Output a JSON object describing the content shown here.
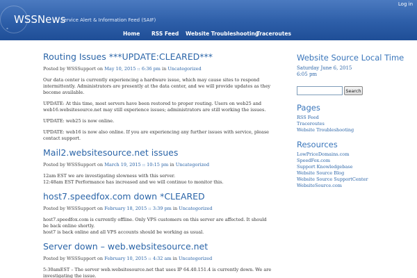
{
  "header": {
    "title": "WSSNews",
    "tagline": "Service Alert & Information Feed (SAIF)",
    "login": "Log in",
    "mark": "°"
  },
  "nav": [
    "Home",
    "RSS Feed",
    "Website Troubleshooting",
    "Traceroutes"
  ],
  "posts": [
    {
      "title": "Routing Issues ***UPDATE:CLEARED***",
      "meta": {
        "posted_by": "Posted by",
        "author": "WSSSupport",
        "on": "on",
        "date": "May 10, 2015 :: 6:36 pm",
        "in": "in",
        "category": "Uncategorized"
      },
      "paragraphs": [
        "Our data center is currently experiencing a hardware issue, which may cause sites to respond intermittently. Administrators are presently at the data center, and we will provide updates as they become available.",
        "UPDATE: At this time, most servers have been restored to proper routing. Users on web25 and web16.websitesource.net may still experience issues; administrators are still working the issues.",
        "UPDATE: web25 is now online.",
        "UPDATE: web16 is now also online. If you are experiencing any further issues with service, please contact support."
      ]
    },
    {
      "title": "Mail2.websitesource.net issues",
      "meta": {
        "posted_by": "Posted by",
        "author": "WSSSupport",
        "on": "on",
        "date": "March 19, 2015 :: 10:15 pm",
        "in": "in",
        "category": "Uncategorized"
      },
      "paragraphs": [
        "12am EST we are investigating slowness with this server.",
        "12:48am EST  Performance has increased and we will continue to monitor this."
      ]
    },
    {
      "title": "host7.speedfox.com down *CLEARED",
      "meta": {
        "posted_by": "Posted by",
        "author": "WSSSupport",
        "on": "on",
        "date": "February 18, 2015 :: 3:39 pm",
        "in": "in",
        "category": "Uncategorized"
      },
      "paragraphs": [
        "host7.speedfox.com is currently offline. Only VPS customers on this server are affected. It should be back online shortly.",
        "host7 is back online and all VPS accounts should be working as usual."
      ]
    },
    {
      "title": "Server down – web.websitesource.net",
      "meta": {
        "posted_by": "Posted by",
        "author": "WSSSupport",
        "on": "on",
        "date": "February 10, 2015 :: 4:32 am",
        "in": "in",
        "category": "Uncategorized"
      },
      "paragraphs": [
        "5:30amEST – The server web.websitesource.net that uses IP 64.40.151.4 is currently down.  We are investigating the issue."
      ]
    }
  ],
  "sidebar": {
    "time_title": "Website Source Local Time",
    "time_date": "Saturday June 6, 2015",
    "time_clock": "6:05 pm",
    "search_placeholder": "",
    "search_button": "Search",
    "pages_title": "Pages",
    "pages": [
      "RSS Feed",
      "Traceroutes",
      "Website Troubleshooting"
    ],
    "resources_title": "Resources",
    "resources": [
      "LowPriceDomains.com",
      "SpeedFox.com",
      "Support Knowledgebase",
      "Website Source Blog",
      "Website Source SupportCenter",
      "WebsiteSource.com"
    ]
  }
}
